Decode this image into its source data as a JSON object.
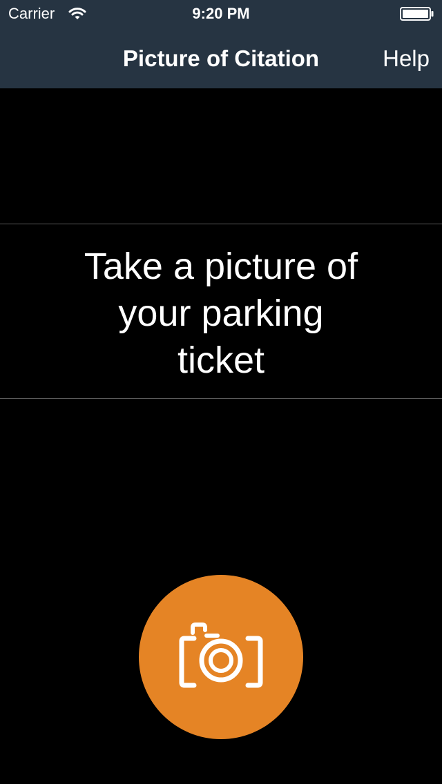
{
  "status_bar": {
    "carrier": "Carrier",
    "time": "9:20 PM",
    "wifi_icon": "wifi-icon",
    "battery_icon": "battery-icon"
  },
  "nav_bar": {
    "title": "Picture of Citation",
    "help_label": "Help"
  },
  "main": {
    "instruction_lines": [
      "Take a picture of",
      "your parking",
      "ticket"
    ]
  },
  "capture": {
    "icon": "camera-icon"
  },
  "colors": {
    "nav_background": "#263442",
    "background": "#000000",
    "accent": "#e58425",
    "text": "#ffffff",
    "divider": "#5c5c5c"
  }
}
